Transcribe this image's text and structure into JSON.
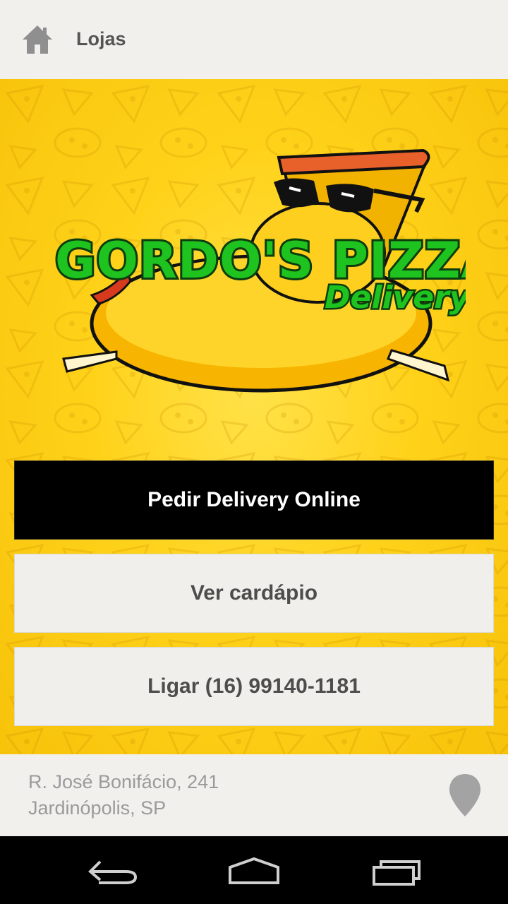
{
  "appbar": {
    "title": "Lojas",
    "home_icon": "home-icon"
  },
  "logo": {
    "line1": "GORDO'S PIZZAS",
    "line2": "Delivery"
  },
  "buttons": {
    "order_online": "Pedir Delivery Online",
    "view_menu": "Ver cardápio",
    "call": "Ligar (16) 99140-1181"
  },
  "footer": {
    "address_line1": "R. José Bonifácio, 241",
    "address_line2": "Jardinópolis, SP",
    "map_icon": "map-pin-icon"
  },
  "navbar": {
    "back_icon": "back-icon",
    "home_icon": "home-nav-icon",
    "recents_icon": "recents-icon"
  },
  "colors": {
    "brand_yellow": "#ffd21a",
    "brand_green": "#1fb81f",
    "primary_button": "#000000",
    "secondary_button": "#f1efec"
  }
}
